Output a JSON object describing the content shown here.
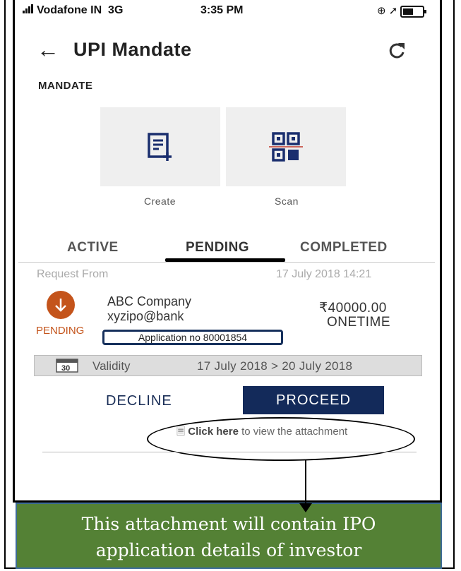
{
  "status_bar": {
    "carrier": "Vodafone IN",
    "network": "3G",
    "time": "3:35 PM"
  },
  "header": {
    "title": "UPI Mandate"
  },
  "section_label": "MANDATE",
  "actions": {
    "create_label": "Create",
    "scan_label": "Scan"
  },
  "tabs": [
    {
      "label": "ACTIVE",
      "selected": false
    },
    {
      "label": "PENDING",
      "selected": true
    },
    {
      "label": "COMPLETED",
      "selected": false
    }
  ],
  "request": {
    "from_label": "Request From",
    "datetime": "17 July 2018 14:21",
    "status": "PENDING",
    "payee_name": "ABC Company",
    "payee_vpa": "xyzipo@bank",
    "amount": "₹40000.00",
    "frequency": "ONETIME",
    "application_no": "Application no 80001854",
    "calendar_day": "30",
    "validity_label": "Validity",
    "validity_range": "17 July 2018 > 20 July 2018"
  },
  "buttons": {
    "decline": "DECLINE",
    "proceed": "PROCEED"
  },
  "attachment": {
    "link_text": "Click here",
    "rest_text": " to view the attachment"
  },
  "callout": {
    "line1": "This attachment will contain IPO",
    "line2": "application details of investor"
  },
  "colors": {
    "pending": "#c4541b",
    "navy": "#132a5a",
    "callout_bg": "#548135",
    "tile_bg": "#efefef"
  }
}
